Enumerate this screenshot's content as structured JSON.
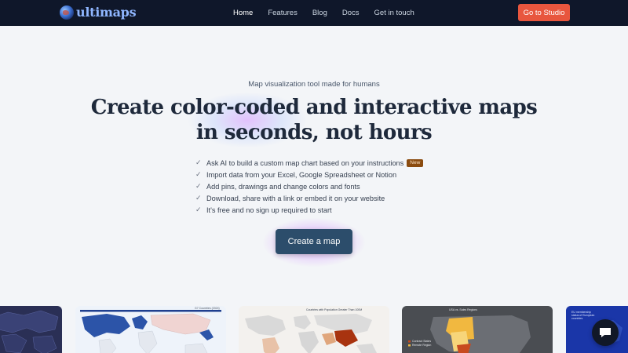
{
  "nav": {
    "logo_text": "ultimaps",
    "links": [
      "Home",
      "Features",
      "Blog",
      "Docs",
      "Get in touch"
    ],
    "active": "Home",
    "cta": "Go to Studio"
  },
  "hero": {
    "tagline": "Map visualization tool made for humans",
    "headline_line1": "Create color-coded and interactive maps",
    "headline_line2": "in seconds, not hours",
    "features": [
      "Ask AI to build a custom map chart based on your instructions",
      "Import data from your Excel, Google Spreadsheet or Notion",
      "Add pins, drawings and change colors and fonts",
      "Download, share with a link or embed it on your website",
      "It's free and no sign up required to start"
    ],
    "new_badge": "New",
    "cta": "Create a map"
  },
  "gallery": {
    "card2_title": "G7 Countries (2024)",
    "card3_title": "Countries with Population Greater Than 100M",
    "card4_title": "USA vs. Sales Regions",
    "card4_legend": [
      "Contract States",
      "Remote Region"
    ],
    "card5_title": "EU membership status of European countries"
  },
  "colors": {
    "nav_bg": "#0f172a",
    "accent": "#e8563e",
    "cta_bg": "#2c4d6b",
    "page_bg": "#f3f5f8"
  },
  "icons": {
    "check": "check-icon",
    "chat": "chat-bubble-icon",
    "logo": "globe-icon"
  }
}
